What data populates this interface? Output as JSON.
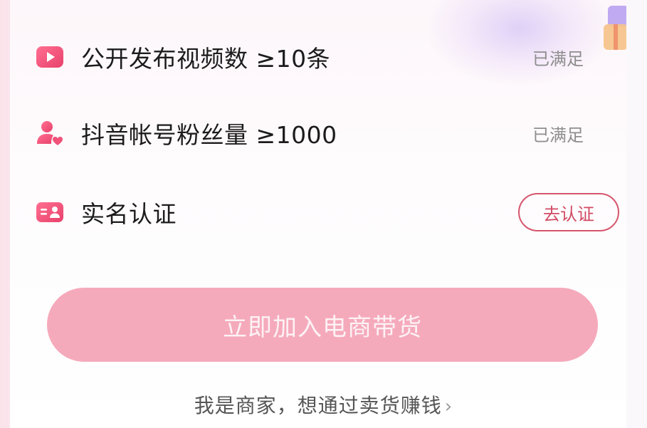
{
  "requirements": [
    {
      "icon": "video-icon",
      "label": "公开发布视频数 ≥10条",
      "status": "已满足"
    },
    {
      "icon": "followers-icon",
      "label": "抖音帐号粉丝量 ≥1000",
      "status": "已满足"
    },
    {
      "icon": "id-card-icon",
      "label": "实名认证",
      "action": "去认证"
    }
  ],
  "join_button": {
    "label": "立即加入电商带货"
  },
  "merchant_link": {
    "label": "我是商家，想通过卖货赚钱",
    "chevron": "›"
  },
  "colors": {
    "accent": "#f5aabb",
    "icon_pink": "#f0527a",
    "verify_border": "#d6556d",
    "status_gray": "#8e8e8e"
  }
}
